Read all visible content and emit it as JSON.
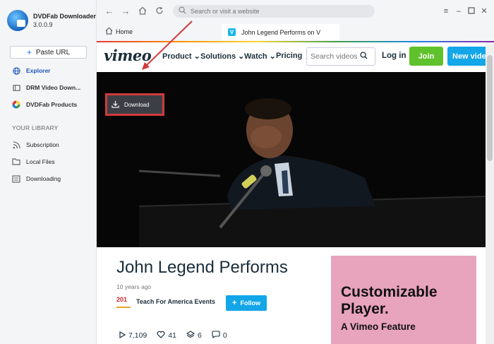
{
  "app": {
    "name": "DVDFab Downloader",
    "version": "3.0.0.9"
  },
  "sidebar": {
    "paste_url": "Paste URL",
    "items": [
      {
        "label": "Explorer"
      },
      {
        "label": "DRM Video Down..."
      },
      {
        "label": "DVDFab Products"
      }
    ],
    "library_label": "YOUR LIBRARY",
    "library_items": [
      {
        "label": "Subscription"
      },
      {
        "label": "Local Files"
      },
      {
        "label": "Downloading"
      }
    ]
  },
  "toolbar": {
    "search_placeholder": "Search or visit a website"
  },
  "tabs": {
    "home": "Home",
    "page": "John Legend Performs on V"
  },
  "vimeo": {
    "logo": "vimeo",
    "menu": [
      "Product",
      "Solutions",
      "Watch",
      "Pricing"
    ],
    "search_placeholder": "Search videos",
    "login": "Log in",
    "join": "Join",
    "new_video": "New video",
    "download": "Download",
    "video_title": "John Legend Performs",
    "uploaded": "10 years ago",
    "owner_logo": "201",
    "owner": "Teach For America Events",
    "follow": "Follow",
    "stats": {
      "plays": "7,109",
      "likes": "41",
      "collections": "6",
      "comments": "0"
    },
    "ad": {
      "title": "Customizable Player.",
      "subtitle": "A Vimeo Feature"
    }
  },
  "colors": {
    "accent": "#13a6e8",
    "join": "#5fc12b",
    "highlight": "#d23a3a",
    "ad_bg": "#e8a3bd"
  }
}
